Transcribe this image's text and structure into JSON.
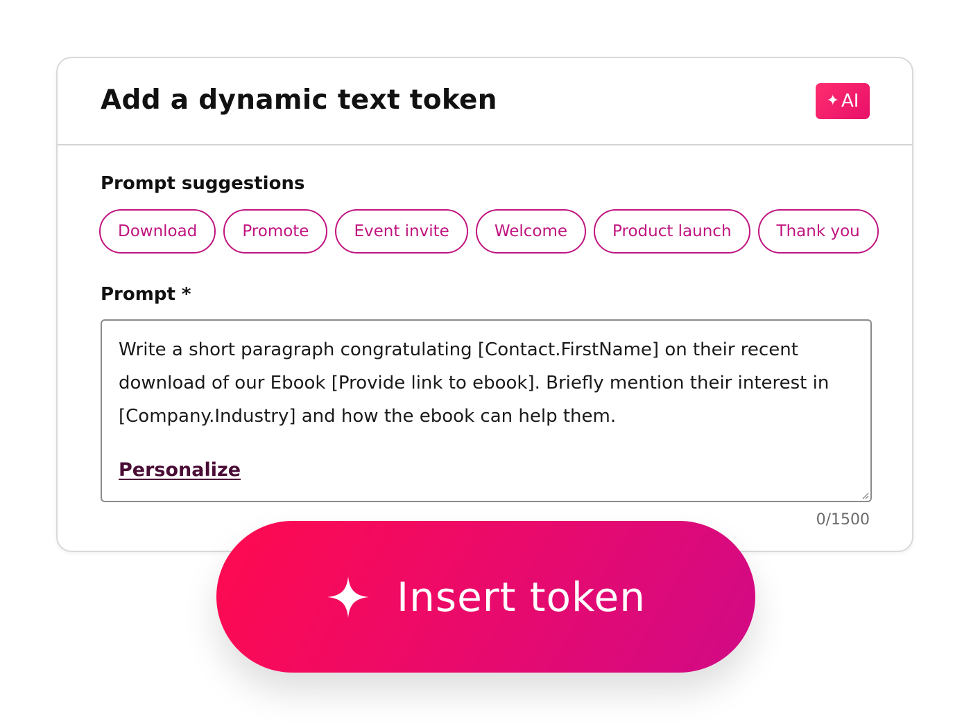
{
  "dialog": {
    "title": "Add a dynamic text token",
    "ai_badge": "AI"
  },
  "suggestions": {
    "label": "Prompt suggestions",
    "chips": [
      "Download",
      "Promote",
      "Event invite",
      "Welcome",
      "Product launch",
      "Thank you"
    ]
  },
  "prompt": {
    "label": "Prompt *",
    "value": "Write a short paragraph congratulating [Contact.FirstName] on their recent download of our Ebook [Provide link to ebook]. Briefly mention their interest in [Company.Industry] and how the ebook can help them.",
    "personalize_label": "Personalize",
    "counter": "0/1500"
  },
  "insert_button": {
    "label": "Insert token"
  },
  "colors": {
    "accent": "#c0147f",
    "ai_badge": "#f0186a",
    "button_start": "#ff0a4f",
    "button_end": "#d10a86",
    "personalize": "#4a0d36"
  },
  "icons": {
    "ai_badge": "sparkle-icon",
    "insert_button": "sparkle-icon"
  }
}
